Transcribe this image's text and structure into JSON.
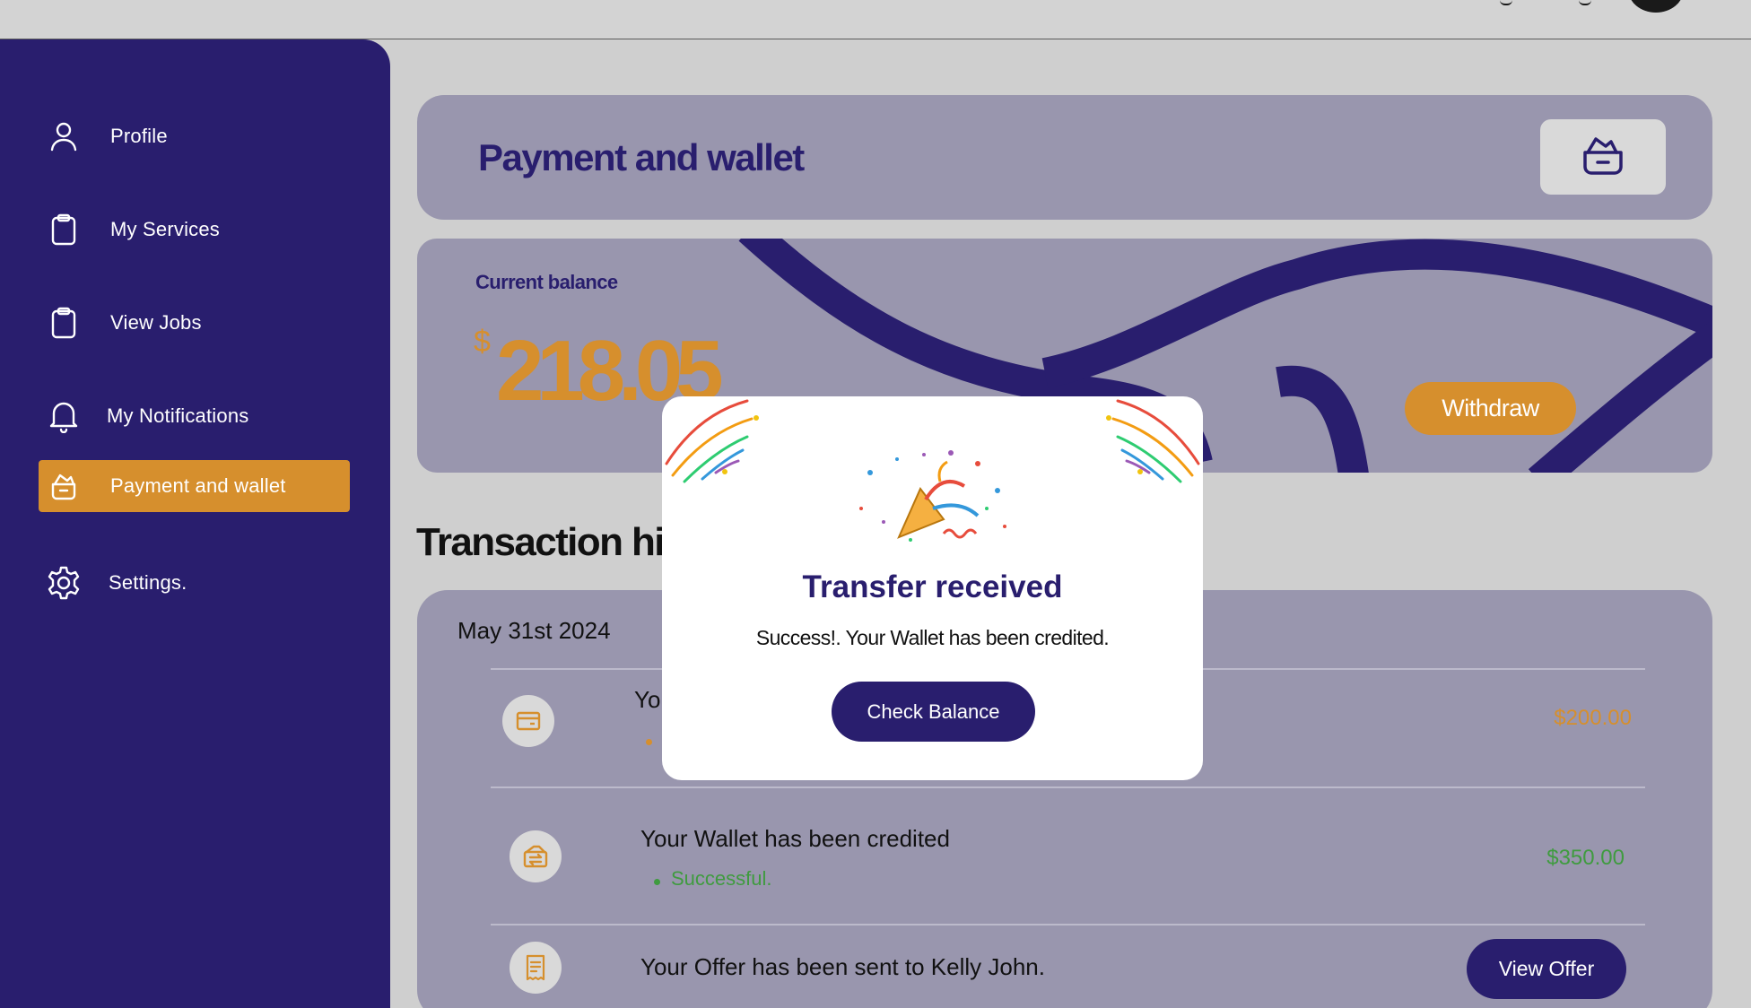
{
  "sidebar": {
    "items": [
      {
        "label": "Profile",
        "icon": "user-icon"
      },
      {
        "label": "My Services",
        "icon": "clipboard-icon"
      },
      {
        "label": "View Jobs",
        "icon": "clipboard-icon"
      },
      {
        "label": "My Notifications",
        "icon": "bell-icon"
      },
      {
        "label": "Payment and wallet",
        "icon": "wallet-icon",
        "active": true
      },
      {
        "label": "Settings.",
        "icon": "gear-icon"
      }
    ]
  },
  "header": {
    "title": "Payment and wallet",
    "button_icon": "wallet-icon"
  },
  "balance": {
    "label": "Current balance",
    "currency": "$",
    "amount": "218.05",
    "withdraw_label": "Withdraw"
  },
  "transactions": {
    "title": "Transaction history",
    "title_visible": "Transaction hist",
    "date": "May 31st 2024",
    "items": [
      {
        "title": "Yo",
        "status": "",
        "amount": "$200.00",
        "icon": "card-icon"
      },
      {
        "title": "Your Wallet has been credited",
        "status": "Successful.",
        "amount": "$350.00",
        "icon": "wallet-transfer-icon"
      },
      {
        "title": "Your Offer has been sent to Kelly John.",
        "button": "View Offer",
        "icon": "receipt-icon"
      }
    ]
  },
  "modal": {
    "title": "Transfer received",
    "message": "Success!. Your Wallet has been credited.",
    "button": "Check Balance",
    "emoji": "🎉"
  },
  "colors": {
    "primary": "#291e6e",
    "accent": "#d68f2d",
    "card": "#9996ae",
    "success": "#3f9b3f"
  }
}
